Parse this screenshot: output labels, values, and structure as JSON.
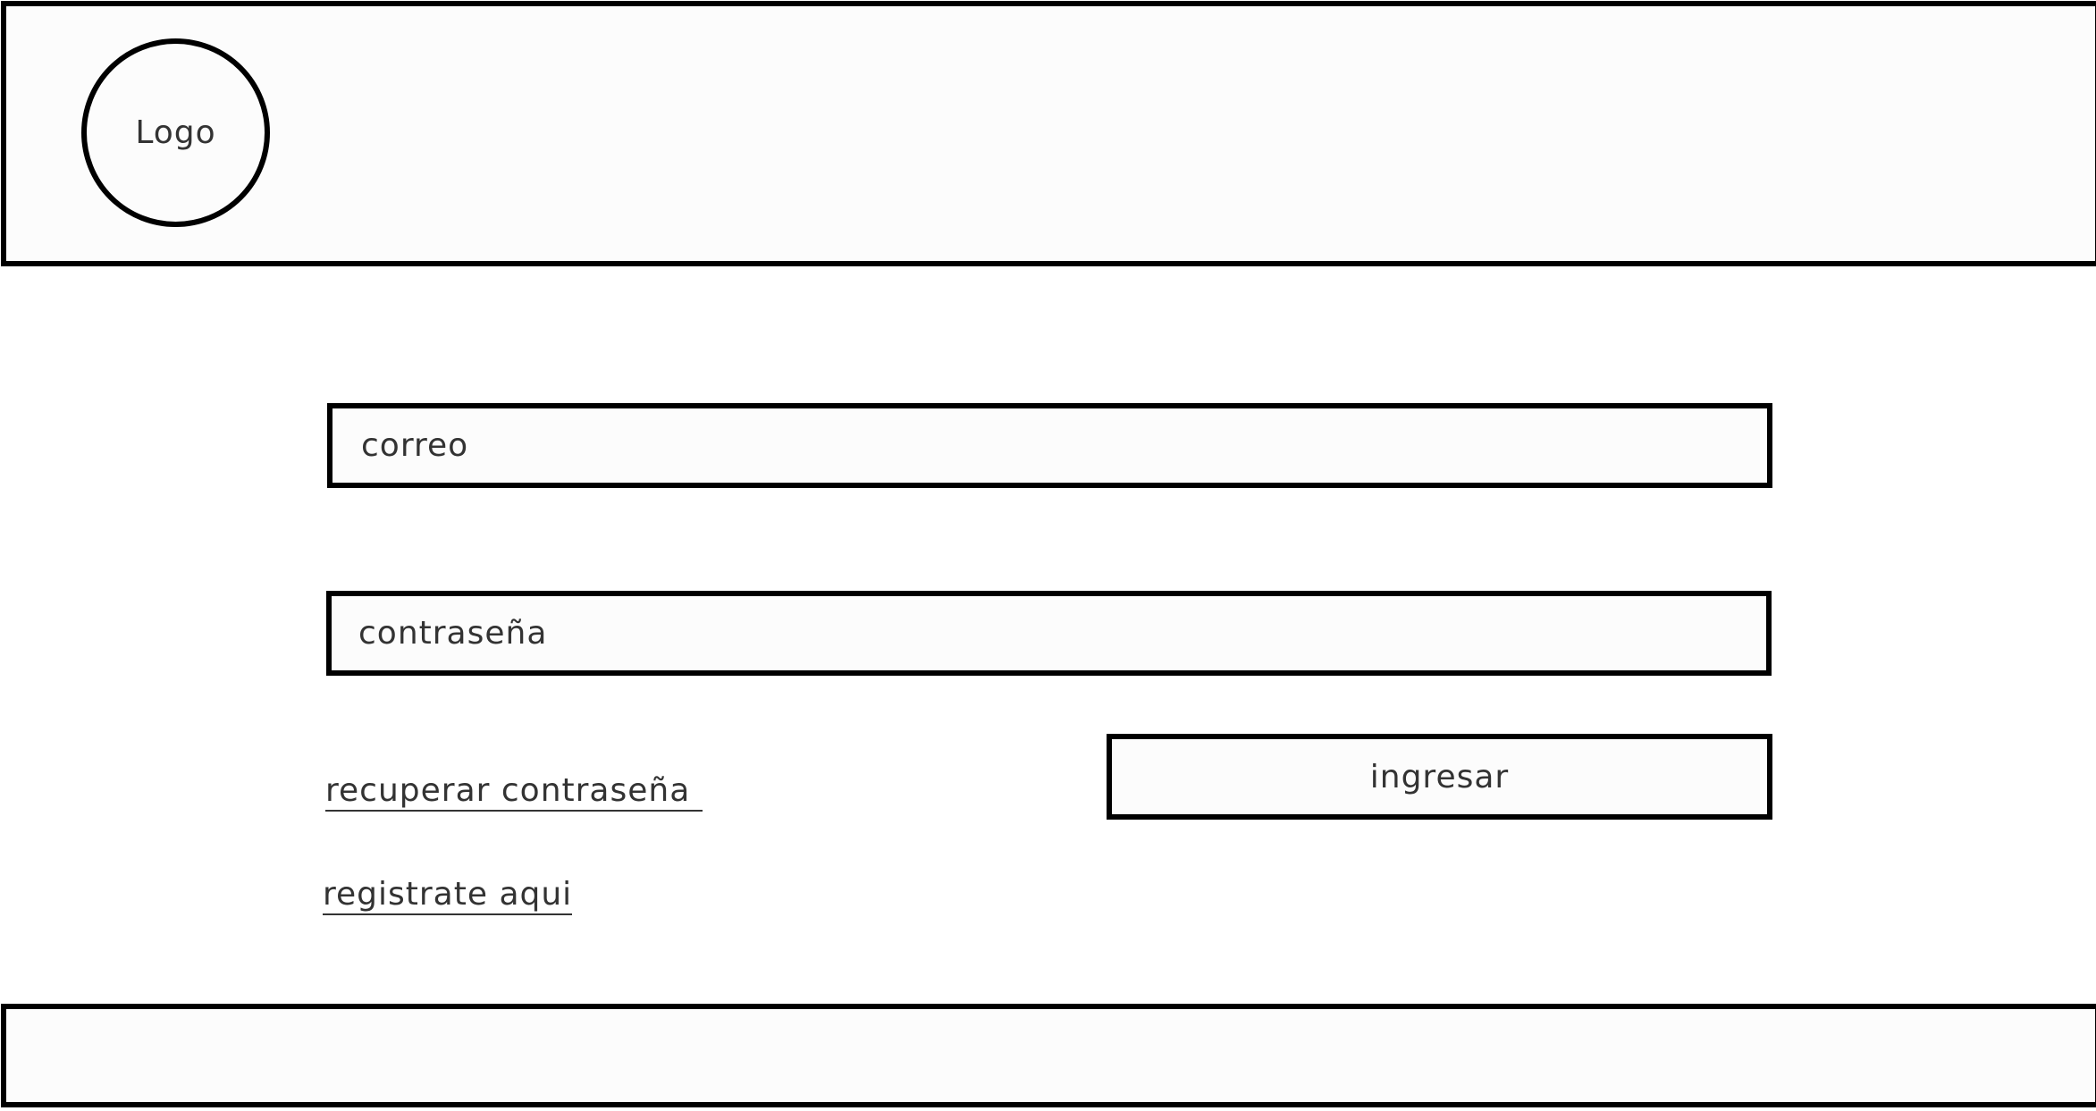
{
  "header": {
    "logo_text": "Logo"
  },
  "login_form": {
    "email_placeholder": "correo",
    "password_placeholder": "contraseña",
    "submit_label": "ingresar",
    "recover_password_label": "recuperar contraseña",
    "register_label": "registrate aqui"
  },
  "footer": {}
}
